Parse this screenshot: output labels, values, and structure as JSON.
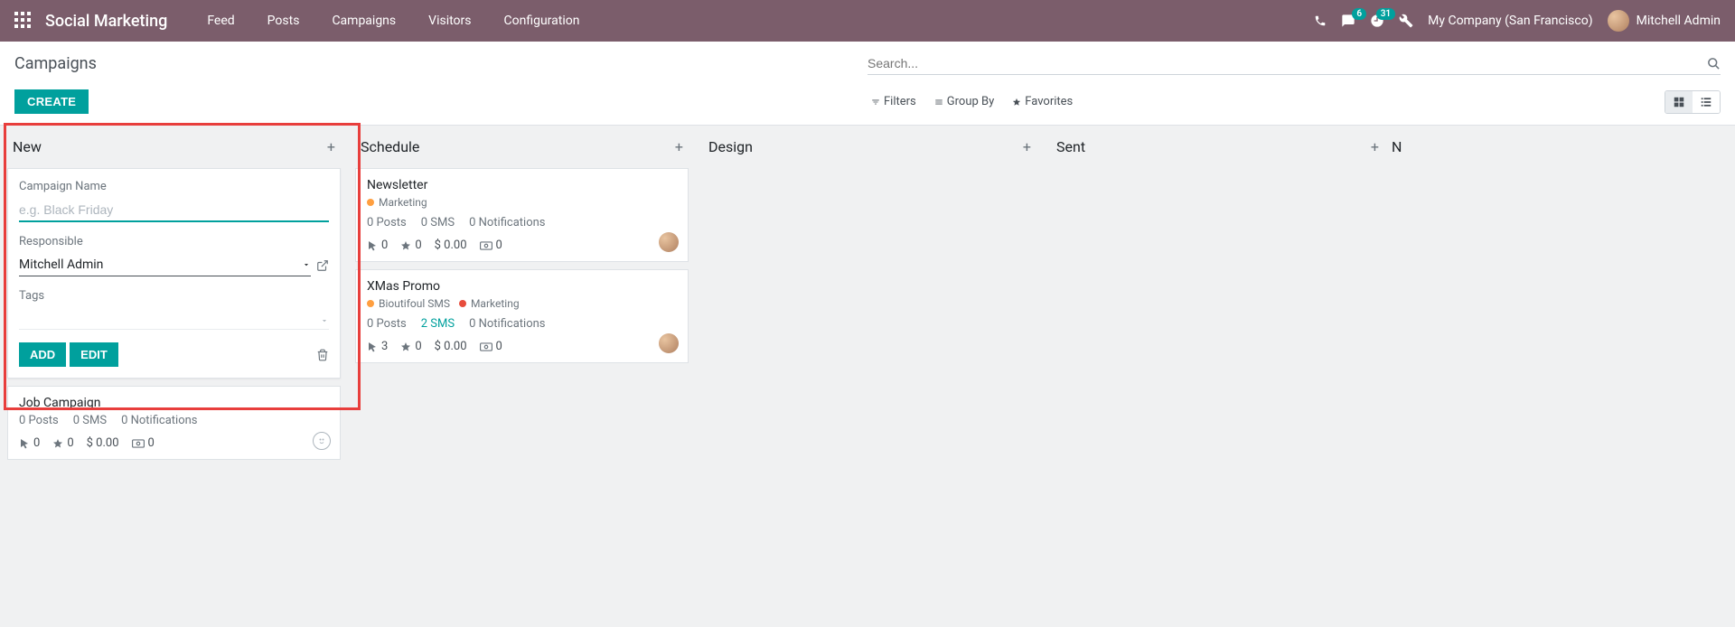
{
  "nav": {
    "brand": "Social Marketing",
    "links": [
      "Feed",
      "Posts",
      "Campaigns",
      "Visitors",
      "Configuration"
    ],
    "msg_badge": "6",
    "activity_badge": "31",
    "company": "My Company (San Francisco)",
    "user": "Mitchell Admin"
  },
  "control": {
    "title": "Campaigns",
    "create": "CREATE",
    "search_placeholder": "Search...",
    "filters": "Filters",
    "groupby": "Group By",
    "favorites": "Favorites"
  },
  "columns": {
    "new": "New",
    "schedule": "Schedule",
    "design": "Design",
    "sent": "Sent",
    "next": "N"
  },
  "quick_create": {
    "name_label": "Campaign Name",
    "name_placeholder": "e.g. Black Friday",
    "responsible_label": "Responsible",
    "responsible_value": "Mitchell Admin",
    "tags_label": "Tags",
    "add": "ADD",
    "edit": "EDIT"
  },
  "cards": {
    "job": {
      "title": "Job Campaign",
      "posts": "0 Posts",
      "sms": "0 SMS",
      "notif": "0 Notifications",
      "clicks": "0",
      "leads": "0",
      "rev": "$ 0.00",
      "quot": "0"
    },
    "newsletter": {
      "title": "Newsletter",
      "tag1": "Marketing",
      "tag1_color": "#ff9f40",
      "posts": "0 Posts",
      "sms": "0 SMS",
      "notif": "0 Notifications",
      "clicks": "0",
      "leads": "0",
      "rev": "$ 0.00",
      "quot": "0"
    },
    "xmas": {
      "title": "XMas Promo",
      "tag1": "Bioutifoul SMS",
      "tag1_color": "#ff9f40",
      "tag2": "Marketing",
      "tag2_color": "#e74c3c",
      "posts": "0 Posts",
      "sms": "2 SMS",
      "notif": "0 Notifications",
      "clicks": "3",
      "leads": "0",
      "rev": "$ 0.00",
      "quot": "0"
    }
  }
}
